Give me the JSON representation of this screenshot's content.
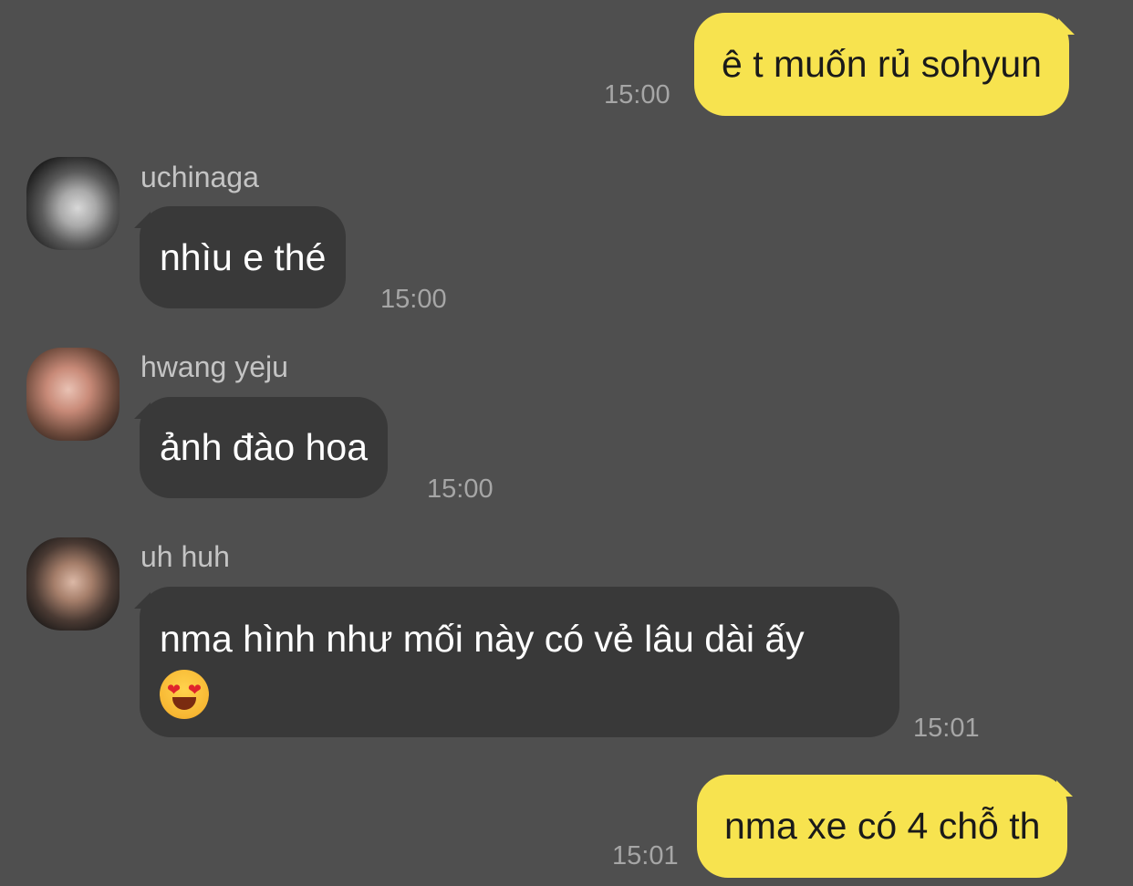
{
  "messages": [
    {
      "direction": "outgoing",
      "text": "ê t muốn rủ sohyun",
      "time": "15:00"
    },
    {
      "direction": "incoming",
      "sender": "uchinaga",
      "text": "nhìu e thé",
      "time": "15:00",
      "avatar_icon": "avatar-photo-icon"
    },
    {
      "direction": "incoming",
      "sender": "hwang yeju",
      "text": "ảnh đào hoa",
      "time": "15:00",
      "avatar_icon": "avatar-photo-icon"
    },
    {
      "direction": "incoming",
      "sender": "uh huh",
      "text": "nma hình như mối này có vẻ lâu dài ấy",
      "emoji": "heart-eyes-emoji",
      "time": "15:01",
      "avatar_icon": "avatar-photo-icon"
    },
    {
      "direction": "outgoing",
      "text": "nma xe có 4 chỗ th",
      "time": "15:01"
    }
  ],
  "colors": {
    "background": "#4f4f4f",
    "outgoing_bubble": "#f7e34f",
    "incoming_bubble": "#393939",
    "timestamp": "#a6a6a6",
    "sender_name": "#c4c4c4"
  }
}
